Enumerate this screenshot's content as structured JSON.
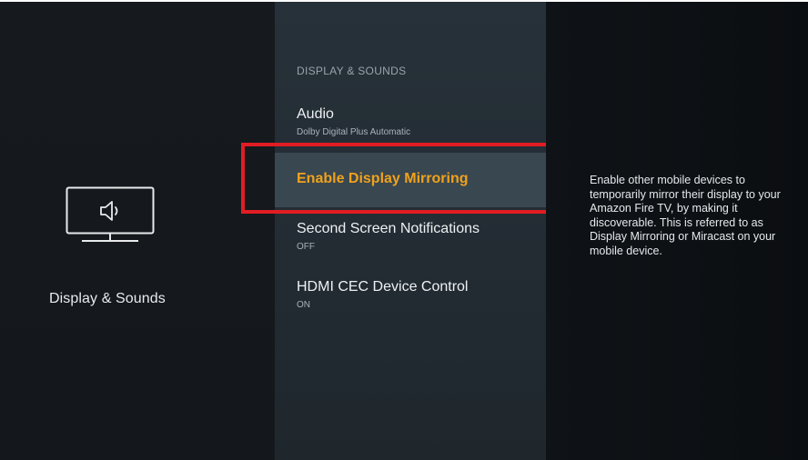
{
  "left": {
    "title": "Display & Sounds",
    "icon": "tv-speaker-icon"
  },
  "menu": {
    "header": "DISPLAY & SOUNDS",
    "items": [
      {
        "label": "Audio",
        "sub": "Dolby Digital Plus Automatic"
      },
      {
        "label": "Enable Display Mirroring",
        "sub": ""
      },
      {
        "label": "Second Screen Notifications",
        "sub": "OFF"
      },
      {
        "label": "HDMI CEC Device Control",
        "sub": "ON"
      }
    ],
    "selected_index": 1
  },
  "description": "Enable other mobile devices to temporarily mirror their display to your Amazon Fire TV, by making it discoverable. This is referred to as Display Mirroring or Miracast on your mobile device.",
  "colors": {
    "selected_text": "#f0a21c",
    "highlight_border": "#e11d23",
    "selected_row_bg": "#394750"
  }
}
